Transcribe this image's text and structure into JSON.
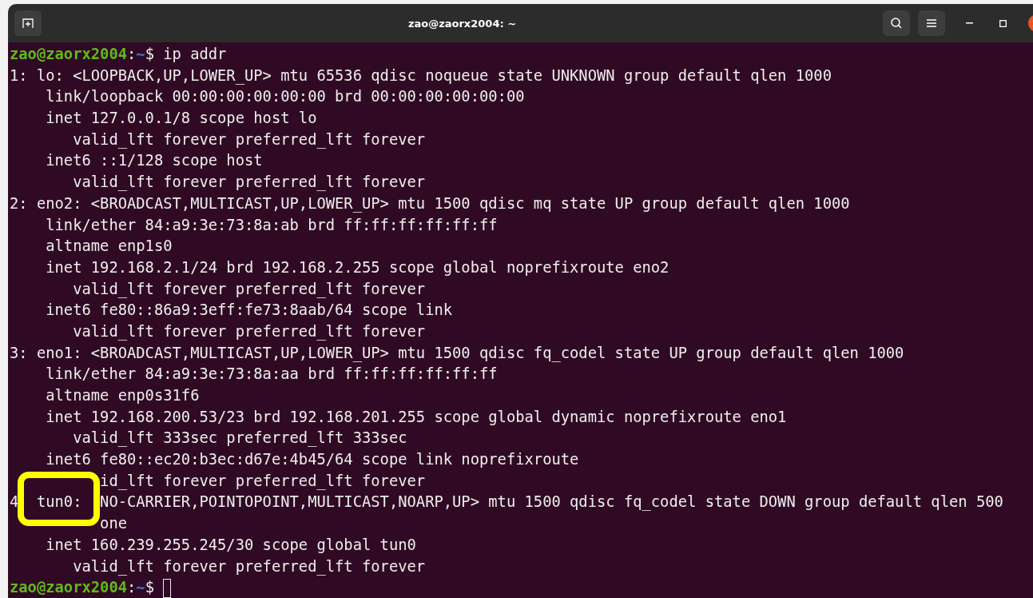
{
  "window": {
    "title": "zao@zaorx2004: ~"
  },
  "terminal": {
    "lines": [
      {
        "kind": "prompt",
        "user": "zao@zaorx2004",
        "separator": ":",
        "path": "~",
        "symbol": "$",
        "command": " ip addr"
      },
      {
        "kind": "output",
        "text": "1: lo: <LOOPBACK,UP,LOWER_UP> mtu 65536 qdisc noqueue state UNKNOWN group default qlen 1000"
      },
      {
        "kind": "output",
        "text": "    link/loopback 00:00:00:00:00:00 brd 00:00:00:00:00:00"
      },
      {
        "kind": "output",
        "text": "    inet 127.0.0.1/8 scope host lo"
      },
      {
        "kind": "output",
        "text": "       valid_lft forever preferred_lft forever"
      },
      {
        "kind": "output",
        "text": "    inet6 ::1/128 scope host"
      },
      {
        "kind": "output",
        "text": "       valid_lft forever preferred_lft forever"
      },
      {
        "kind": "output",
        "text": "2: eno2: <BROADCAST,MULTICAST,UP,LOWER_UP> mtu 1500 qdisc mq state UP group default qlen 1000"
      },
      {
        "kind": "output",
        "text": "    link/ether 84:a9:3e:73:8a:ab brd ff:ff:ff:ff:ff:ff"
      },
      {
        "kind": "output",
        "text": "    altname enp1s0"
      },
      {
        "kind": "output",
        "text": "    inet 192.168.2.1/24 brd 192.168.2.255 scope global noprefixroute eno2"
      },
      {
        "kind": "output",
        "text": "       valid_lft forever preferred_lft forever"
      },
      {
        "kind": "output",
        "text": "    inet6 fe80::86a9:3eff:fe73:8aab/64 scope link"
      },
      {
        "kind": "output",
        "text": "       valid_lft forever preferred_lft forever"
      },
      {
        "kind": "output",
        "text": "3: eno1: <BROADCAST,MULTICAST,UP,LOWER_UP> mtu 1500 qdisc fq_codel state UP group default qlen 1000"
      },
      {
        "kind": "output",
        "text": "    link/ether 84:a9:3e:73:8a:aa brd ff:ff:ff:ff:ff:ff"
      },
      {
        "kind": "output",
        "text": "    altname enp0s31f6"
      },
      {
        "kind": "output",
        "text": "    inet 192.168.200.53/23 brd 192.168.201.255 scope global dynamic noprefixroute eno1"
      },
      {
        "kind": "output",
        "text": "       valid_lft 333sec preferred_lft 333sec"
      },
      {
        "kind": "output",
        "text": "    inet6 fe80::ec20:b3ec:d67e:4b45/64 scope link noprefixroute"
      },
      {
        "kind": "output",
        "text": "          id_lft forever preferred_lft forever"
      },
      {
        "kind": "output",
        "text": "4  tun0:  NO-CARRIER,POINTOPOINT,MULTICAST,NOARP,UP> mtu 1500 qdisc fq_codel state DOWN group default qlen 500"
      },
      {
        "kind": "output",
        "text": "          one"
      },
      {
        "kind": "output",
        "text": "    inet 160.239.255.245/30 scope global tun0"
      },
      {
        "kind": "output",
        "text": "       valid_lft forever preferred_lft forever"
      },
      {
        "kind": "prompt",
        "user": "zao@zaorx2004",
        "separator": ":",
        "path": "~",
        "symbol": "$",
        "cursor": true
      }
    ]
  }
}
